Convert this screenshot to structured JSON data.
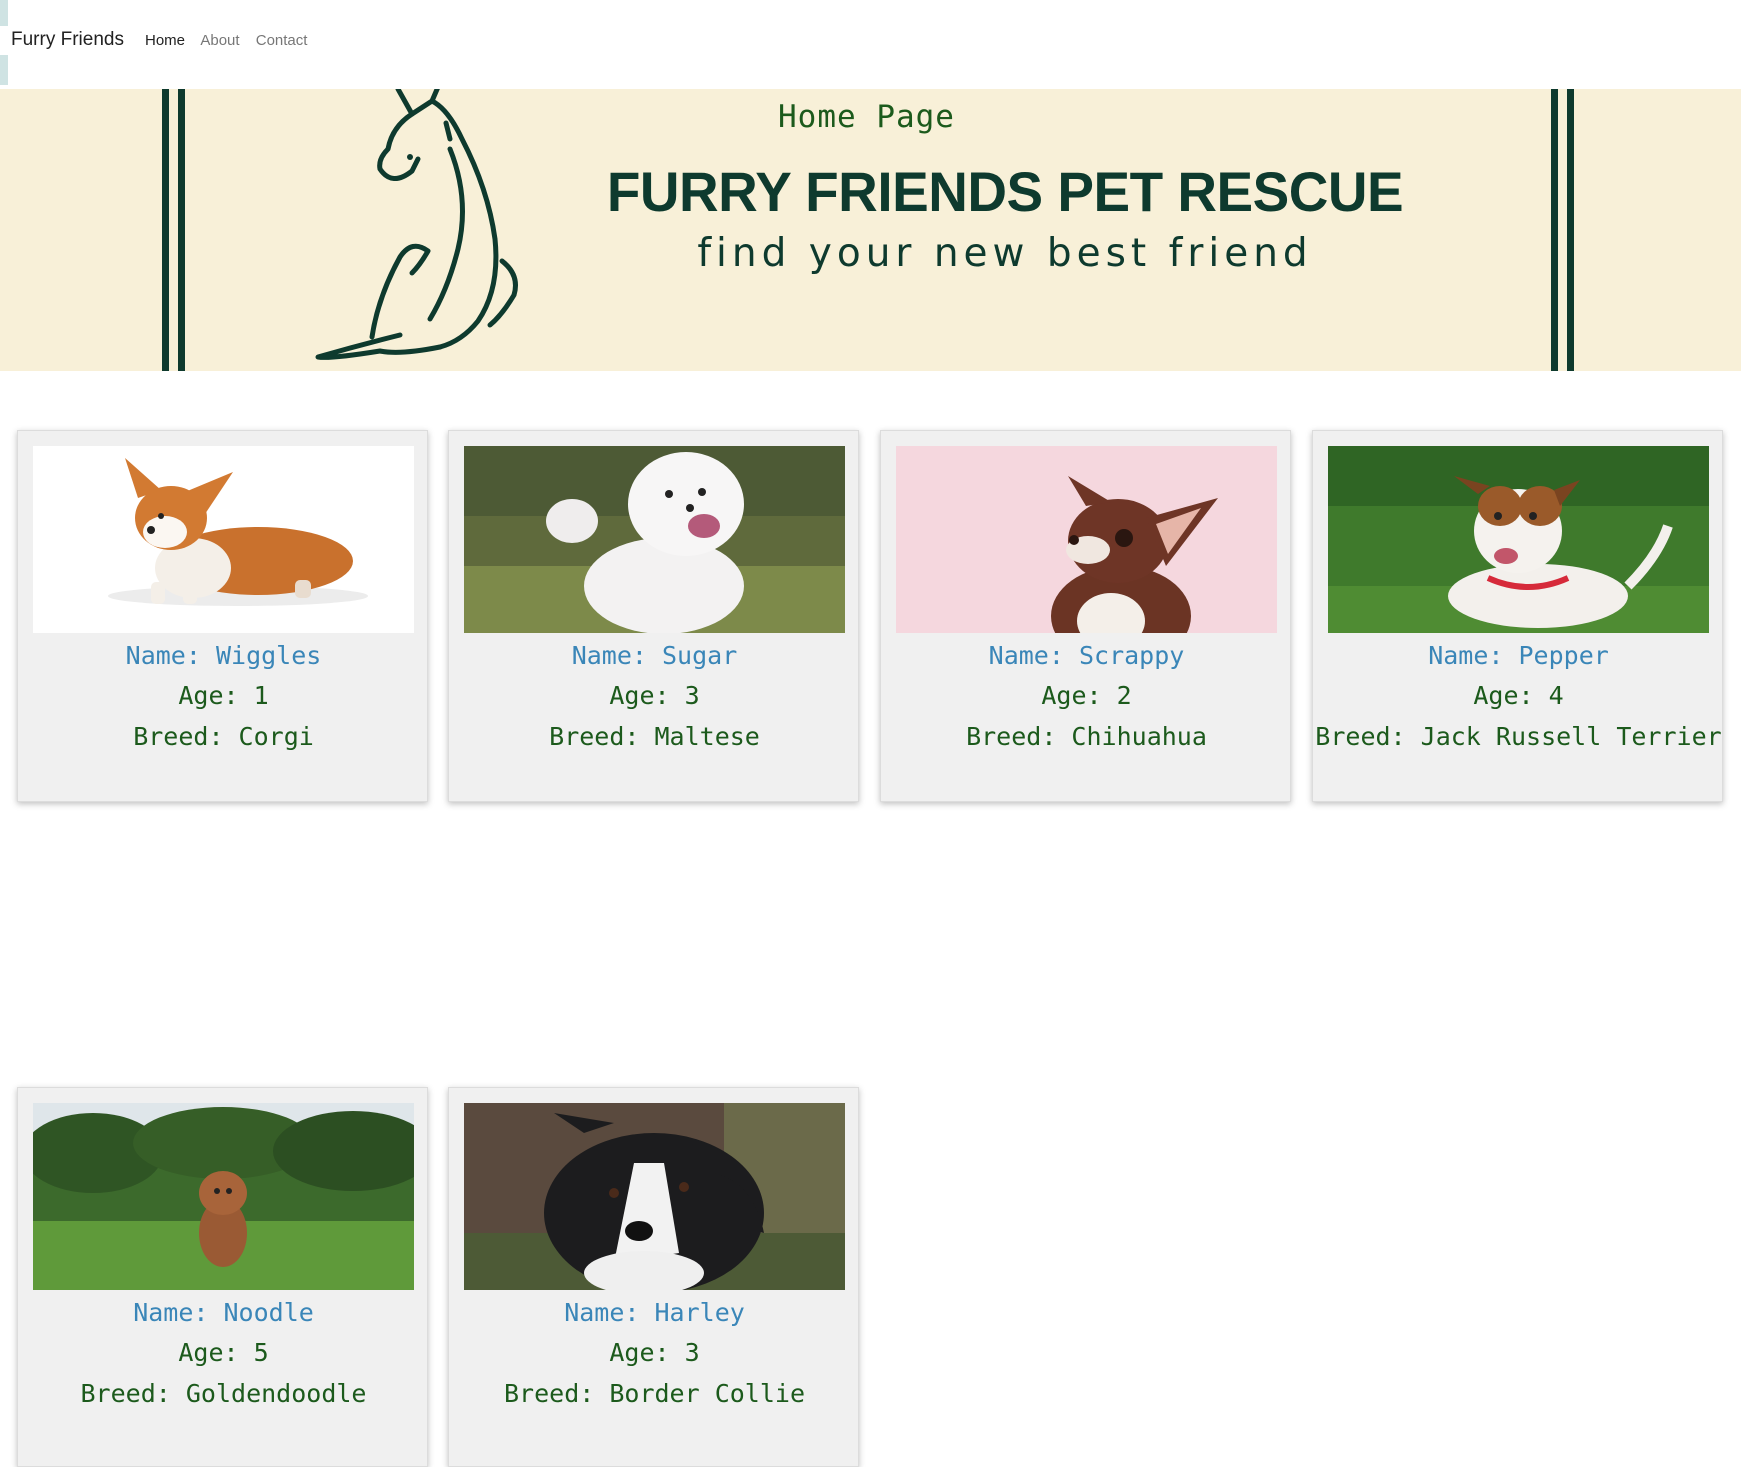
{
  "navbar": {
    "brand": "Furry Friends",
    "links": [
      {
        "label": "Home",
        "active": true
      },
      {
        "label": "About",
        "active": false
      },
      {
        "label": "Contact",
        "active": false
      }
    ]
  },
  "banner": {
    "subtitle": "Home Page",
    "title": "FURRY FRIENDS PET RESCUE",
    "tagline": "find your new best friend",
    "colors": {
      "background": "#f8f0d8",
      "ink": "#0e3a2e"
    }
  },
  "pets": [
    {
      "name": "Name: Wiggles",
      "age": "Age: 1",
      "breed": "Breed: Corgi"
    },
    {
      "name": "Name: Sugar",
      "age": "Age: 3",
      "breed": "Breed: Maltese"
    },
    {
      "name": "Name: Scrappy",
      "age": "Age: 2",
      "breed": "Breed: Chihuahua"
    },
    {
      "name": "Name: Pepper",
      "age": "Age: 4",
      "breed": "Breed: Jack Russell Terrier"
    },
    {
      "name": "Name: Noodle",
      "age": "Age: 5",
      "breed": "Breed: Goldendoodle"
    },
    {
      "name": "Name: Harley",
      "age": "Age: 3",
      "breed": "Breed: Border Collie"
    }
  ],
  "colors": {
    "name_text": "#3a86b8",
    "info_text": "#1c5a1c",
    "card_background": "#f0f0f0"
  }
}
